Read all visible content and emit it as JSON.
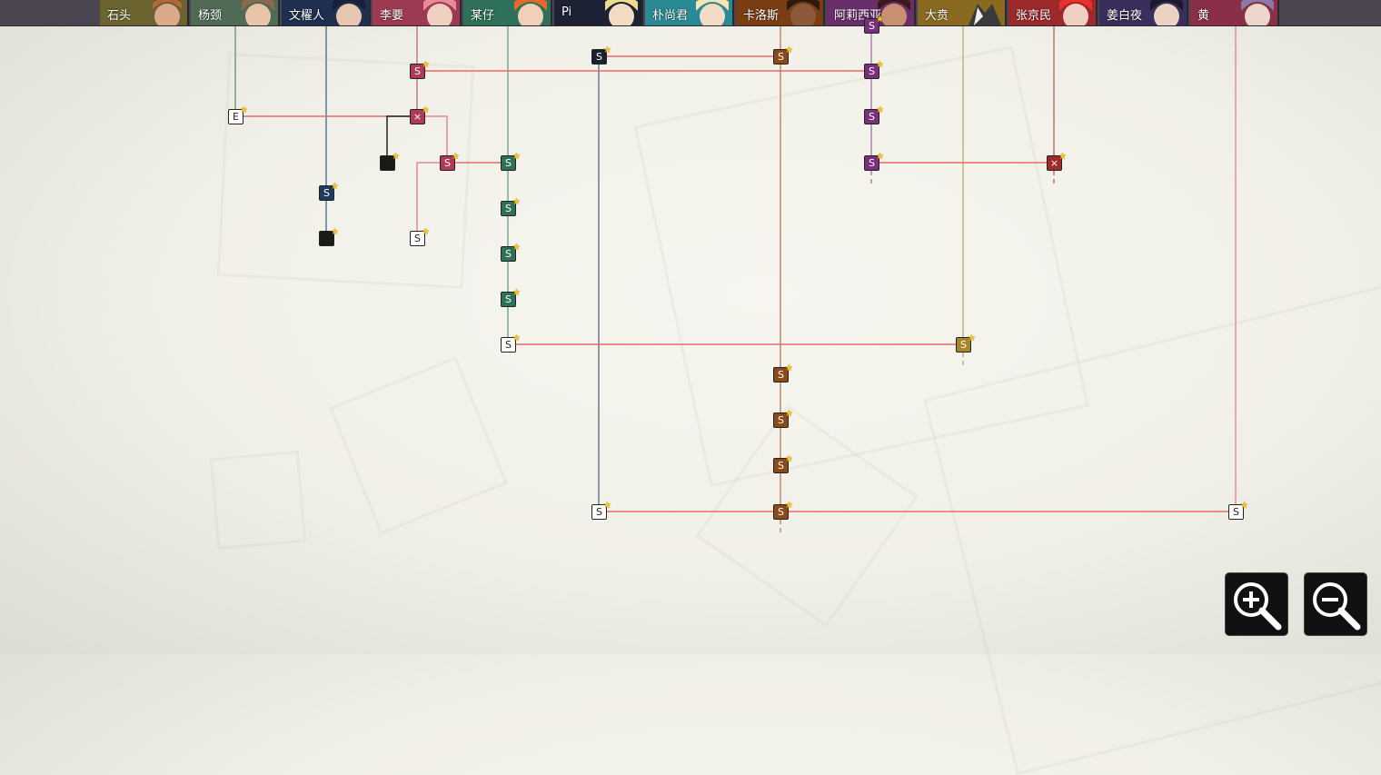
{
  "characters": [
    {
      "name": "石头",
      "color": "#6b6430"
    },
    {
      "name": "杨颈",
      "color": "#4f6b55"
    },
    {
      "name": "文櫂人",
      "color": "#1f2f4f"
    },
    {
      "name": "李要",
      "color": "#9c3a52"
    },
    {
      "name": "某仔",
      "color": "#2f7058"
    },
    {
      "name": "Pi",
      "color": "#1c2233"
    },
    {
      "name": "朴尚君",
      "color": "#2a8a94"
    },
    {
      "name": "卡洛斯",
      "color": "#7a3e14"
    },
    {
      "name": "阿莉西亚",
      "color": "#6a2f6a"
    },
    {
      "name": "大贲",
      "color": "#8a6a20"
    },
    {
      "name": "张京民",
      "color": "#9c2a2a"
    },
    {
      "name": "姜白夜",
      "color": "#3a2f5c"
    },
    {
      "name": "黄",
      "color": "#8a2f48"
    }
  ],
  "node_glyphs": {
    "s": "S",
    "e": "E",
    "x": "×",
    "star": "★"
  },
  "icons": {
    "zoom_in": "zoom-in-icon",
    "zoom_out": "zoom-out-icon"
  }
}
